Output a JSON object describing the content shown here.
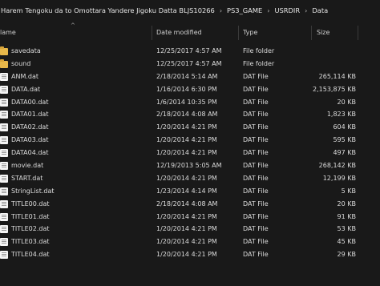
{
  "breadcrumb": [
    "Harem Tengoku da to Omottara Yandere Jigoku Datta BLJS10266",
    "PS3_GAME",
    "USRDIR",
    "Data"
  ],
  "breadcrumb_separator": "›",
  "columns": {
    "name": "Name",
    "name_visible": "lame",
    "date": "Date modified",
    "type": "Type",
    "size": "Size"
  },
  "sort_indicator": "^",
  "files": [
    {
      "name": "savedata",
      "date": "12/25/2017 4:57 AM",
      "type": "File folder",
      "size": "",
      "icon": "folder-icon"
    },
    {
      "name": "sound",
      "date": "12/25/2017 4:57 AM",
      "type": "File folder",
      "size": "",
      "icon": "folder-icon"
    },
    {
      "name": "ANM.dat",
      "date": "2/18/2014 5:14 AM",
      "type": "DAT File",
      "size": "265,114 KB",
      "icon": "file-icon"
    },
    {
      "name": "DATA.dat",
      "date": "1/16/2014 6:30 PM",
      "type": "DAT File",
      "size": "2,153,875 KB",
      "icon": "file-icon"
    },
    {
      "name": "DATA00.dat",
      "date": "1/6/2014 10:35 PM",
      "type": "DAT File",
      "size": "20 KB",
      "icon": "file-icon"
    },
    {
      "name": "DATA01.dat",
      "date": "2/18/2014 4:08 AM",
      "type": "DAT File",
      "size": "1,823 KB",
      "icon": "file-icon"
    },
    {
      "name": "DATA02.dat",
      "date": "1/20/2014 4:21 PM",
      "type": "DAT File",
      "size": "604 KB",
      "icon": "file-icon"
    },
    {
      "name": "DATA03.dat",
      "date": "1/20/2014 4:21 PM",
      "type": "DAT File",
      "size": "595 KB",
      "icon": "file-icon"
    },
    {
      "name": "DATA04.dat",
      "date": "1/20/2014 4:21 PM",
      "type": "DAT File",
      "size": "497 KB",
      "icon": "file-icon"
    },
    {
      "name": "movie.dat",
      "date": "12/19/2013 5:05 AM",
      "type": "DAT File",
      "size": "268,142 KB",
      "icon": "file-icon"
    },
    {
      "name": "START.dat",
      "date": "1/20/2014 4:21 PM",
      "type": "DAT File",
      "size": "12,199 KB",
      "icon": "file-icon"
    },
    {
      "name": "StringList.dat",
      "date": "1/23/2014 4:14 PM",
      "type": "DAT File",
      "size": "5 KB",
      "icon": "file-icon"
    },
    {
      "name": "TITLE00.dat",
      "date": "2/18/2014 4:08 AM",
      "type": "DAT File",
      "size": "20 KB",
      "icon": "file-icon"
    },
    {
      "name": "TITLE01.dat",
      "date": "1/20/2014 4:21 PM",
      "type": "DAT File",
      "size": "91 KB",
      "icon": "file-icon"
    },
    {
      "name": "TITLE02.dat",
      "date": "1/20/2014 4:21 PM",
      "type": "DAT File",
      "size": "53 KB",
      "icon": "file-icon"
    },
    {
      "name": "TITLE03.dat",
      "date": "1/20/2014 4:21 PM",
      "type": "DAT File",
      "size": "45 KB",
      "icon": "file-icon"
    },
    {
      "name": "TITLE04.dat",
      "date": "1/20/2014 4:21 PM",
      "type": "DAT File",
      "size": "29 KB",
      "icon": "file-icon"
    }
  ]
}
